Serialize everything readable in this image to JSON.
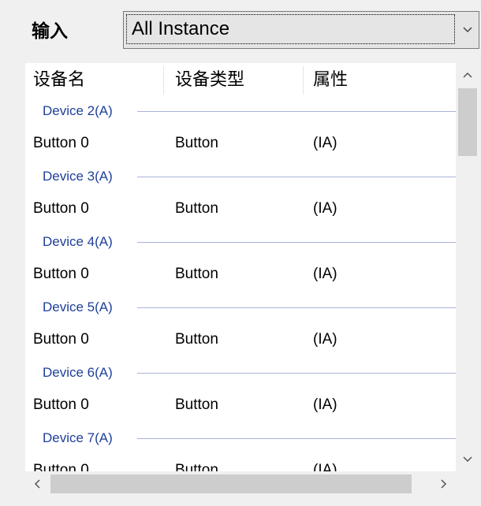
{
  "input_label": "输入",
  "instance_select": {
    "value": "All Instance"
  },
  "columns": [
    "设备名",
    "设备类型",
    "属性"
  ],
  "groups": [
    {
      "label": "Device 2(A)",
      "rows": [
        {
          "name": "Button 0",
          "type": "Button",
          "attr": "(IA)"
        }
      ]
    },
    {
      "label": "Device 3(A)",
      "rows": [
        {
          "name": "Button 0",
          "type": "Button",
          "attr": "(IA)"
        }
      ]
    },
    {
      "label": "Device 4(A)",
      "rows": [
        {
          "name": "Button 0",
          "type": "Button",
          "attr": "(IA)"
        }
      ]
    },
    {
      "label": "Device 5(A)",
      "rows": [
        {
          "name": "Button 0",
          "type": "Button",
          "attr": "(IA)"
        }
      ]
    },
    {
      "label": "Device 6(A)",
      "rows": [
        {
          "name": "Button 0",
          "type": "Button",
          "attr": "(IA)"
        }
      ]
    },
    {
      "label": "Device 7(A)",
      "rows": [
        {
          "name": "Button 0",
          "type": "Button",
          "attr": "(IA)"
        }
      ]
    }
  ],
  "icons": {
    "select_arrow": "chevron-down-icon",
    "scroll_up": "chevron-up-icon",
    "scroll_down": "chevron-down-icon",
    "scroll_left": "chevron-left-icon",
    "scroll_right": "chevron-right-icon"
  },
  "colors": {
    "group_label": "#1e3f9a",
    "group_line": "#a8b3d8"
  }
}
